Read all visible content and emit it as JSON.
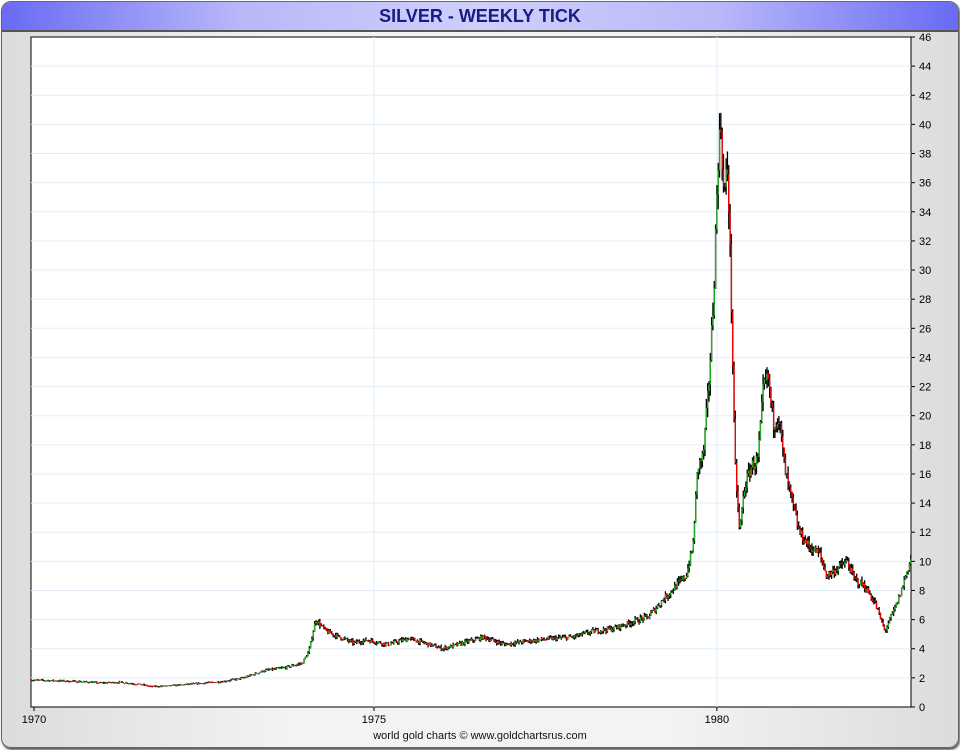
{
  "chart_data": {
    "type": "candlestick",
    "title": "SILVER - WEEKLY TICK",
    "xlabel": "",
    "ylabel": "",
    "x_ticks": [
      "1970",
      "1975",
      "1980"
    ],
    "y_ticks": [
      0,
      2,
      4,
      6,
      8,
      10,
      12,
      14,
      16,
      18,
      20,
      22,
      24,
      26,
      28,
      30,
      32,
      34,
      36,
      38,
      40,
      42,
      44,
      46
    ],
    "xlim": [
      1970.0,
      1982.83
    ],
    "ylim": [
      0,
      46
    ],
    "y_axis_side": "right",
    "grid": true,
    "up_color": "#22b022",
    "down_color": "#ff0000",
    "wick_color": "#000000",
    "key_points": [
      [
        1970.0,
        1.85
      ],
      [
        1970.4,
        1.8
      ],
      [
        1970.7,
        1.75
      ],
      [
        1971.0,
        1.65
      ],
      [
        1971.3,
        1.7
      ],
      [
        1971.6,
        1.55
      ],
      [
        1971.75,
        1.4
      ],
      [
        1972.0,
        1.45
      ],
      [
        1972.4,
        1.6
      ],
      [
        1972.8,
        1.75
      ],
      [
        1973.1,
        2.0
      ],
      [
        1973.4,
        2.5
      ],
      [
        1973.7,
        2.7
      ],
      [
        1973.95,
        3.0
      ],
      [
        1974.05,
        3.8
      ],
      [
        1974.15,
        6.0
      ],
      [
        1974.3,
        5.2
      ],
      [
        1974.5,
        4.8
      ],
      [
        1974.7,
        4.4
      ],
      [
        1974.9,
        4.6
      ],
      [
        1975.2,
        4.3
      ],
      [
        1975.5,
        4.7
      ],
      [
        1975.8,
        4.3
      ],
      [
        1976.0,
        4.0
      ],
      [
        1976.3,
        4.4
      ],
      [
        1976.6,
        4.8
      ],
      [
        1976.9,
        4.3
      ],
      [
        1977.2,
        4.5
      ],
      [
        1977.6,
        4.7
      ],
      [
        1977.9,
        4.8
      ],
      [
        1978.2,
        5.2
      ],
      [
        1978.5,
        5.4
      ],
      [
        1978.8,
        5.9
      ],
      [
        1979.0,
        6.2
      ],
      [
        1979.2,
        7.3
      ],
      [
        1979.4,
        8.3
      ],
      [
        1979.55,
        9.0
      ],
      [
        1979.65,
        11
      ],
      [
        1979.72,
        16.5
      ],
      [
        1979.8,
        17.2
      ],
      [
        1979.88,
        22
      ],
      [
        1979.95,
        28
      ],
      [
        1980.02,
        38
      ],
      [
        1980.06,
        40
      ],
      [
        1980.1,
        35
      ],
      [
        1980.16,
        37
      ],
      [
        1980.22,
        26
      ],
      [
        1980.26,
        17
      ],
      [
        1980.33,
        12
      ],
      [
        1980.4,
        15
      ],
      [
        1980.5,
        16.5
      ],
      [
        1980.6,
        17
      ],
      [
        1980.68,
        22
      ],
      [
        1980.75,
        22.5
      ],
      [
        1980.82,
        19.5
      ],
      [
        1980.9,
        20
      ],
      [
        1981.0,
        16
      ],
      [
        1981.1,
        14
      ],
      [
        1981.2,
        12
      ],
      [
        1981.35,
        11
      ],
      [
        1981.5,
        10.5
      ],
      [
        1981.6,
        9
      ],
      [
        1981.75,
        9.5
      ],
      [
        1981.9,
        10
      ],
      [
        1982.0,
        8.8
      ],
      [
        1982.15,
        8.3
      ],
      [
        1982.3,
        7.2
      ],
      [
        1982.45,
        5.2
      ],
      [
        1982.55,
        6.3
      ],
      [
        1982.65,
        7.4
      ],
      [
        1982.75,
        9.0
      ],
      [
        1982.83,
        10.2
      ]
    ]
  },
  "footer": "world gold charts © www.goldchartsrus.com"
}
